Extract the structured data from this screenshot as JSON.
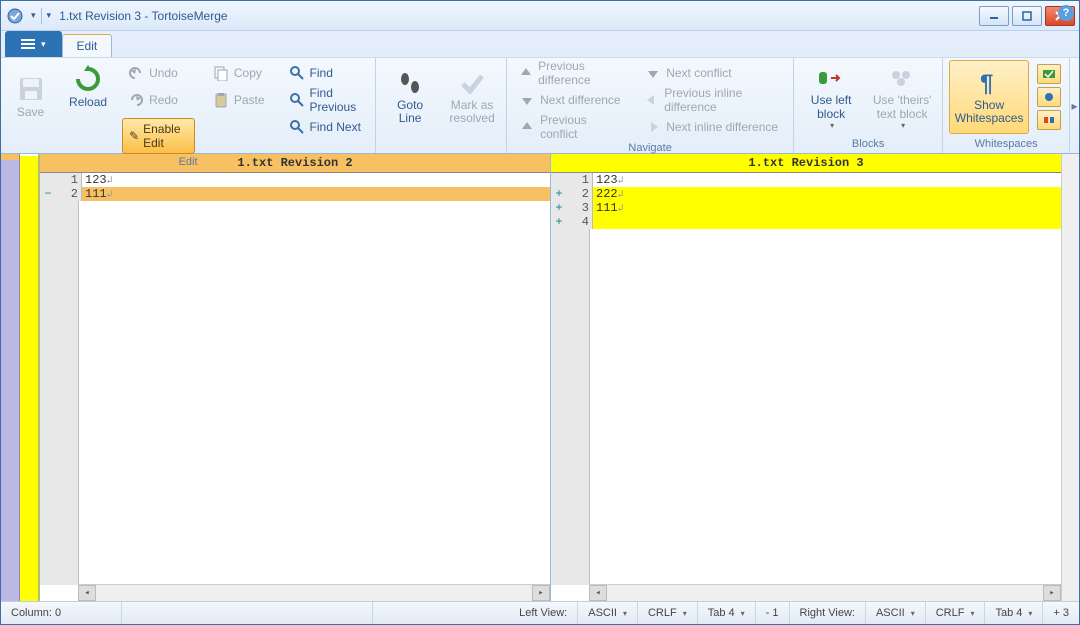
{
  "window": {
    "title": "1.txt Revision 3 - TortoiseMerge"
  },
  "ribbon": {
    "file_menu": "",
    "tabs": {
      "edit": "Edit"
    },
    "save": "Save",
    "reload": "Reload",
    "undo": "Undo",
    "redo": "Redo",
    "enable_edit": "Enable Edit",
    "copy": "Copy",
    "paste": "Paste",
    "find": "Find",
    "find_previous": "Find Previous",
    "find_next": "Find Next",
    "goto_line": "Goto Line",
    "mark_resolved": "Mark as resolved",
    "prev_diff": "Previous difference",
    "next_diff": "Next difference",
    "prev_conflict": "Previous conflict",
    "next_conflict": "Next conflict",
    "prev_inline": "Previous inline difference",
    "next_inline": "Next inline difference",
    "use_left": "Use left block",
    "use_theirs": "Use 'theirs' text block",
    "show_whitespaces": "Show Whitespaces",
    "group_edit": "Edit",
    "group_navigate": "Navigate",
    "group_blocks": "Blocks",
    "group_whitespaces": "Whitespaces"
  },
  "panes": {
    "left": {
      "title": "1.txt Revision 2",
      "lines": [
        {
          "n": "1",
          "marker": "",
          "text": "123",
          "cls": "norm"
        },
        {
          "n": "2",
          "marker": "−",
          "text": "111",
          "cls": "rem"
        }
      ]
    },
    "right": {
      "title": "1.txt Revision 3",
      "lines": [
        {
          "n": "1",
          "marker": "",
          "text": "123",
          "cls": "norm"
        },
        {
          "n": "2",
          "marker": "+",
          "text": "222",
          "cls": "add"
        },
        {
          "n": "3",
          "marker": "+",
          "text": "111",
          "cls": "add"
        },
        {
          "n": "4",
          "marker": "+",
          "text": "",
          "cls": "add"
        }
      ]
    }
  },
  "status": {
    "column": "Column: 0",
    "left_view_label": "Left View:",
    "right_view_label": "Right View:",
    "encoding": "ASCII",
    "eol": "CRLF",
    "tab": "Tab 4",
    "left_count": "- 1",
    "right_count": "+ 3"
  }
}
